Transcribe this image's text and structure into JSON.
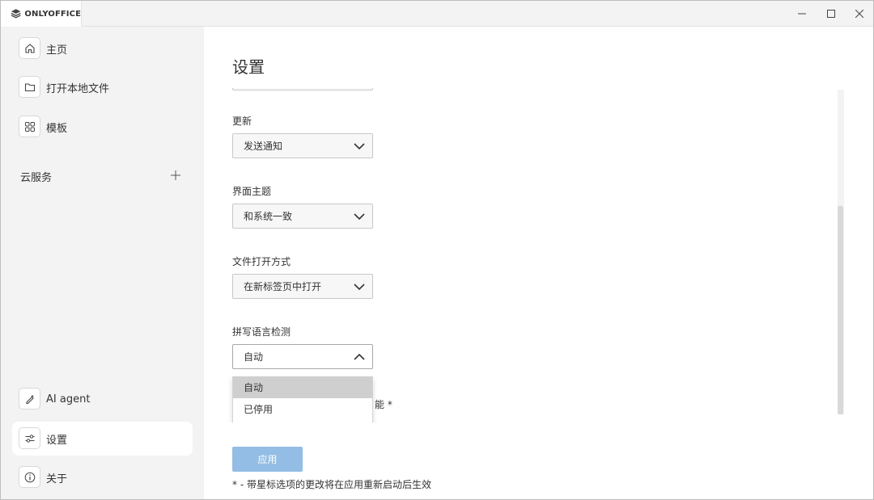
{
  "app": {
    "brand": "ONLYOFFICE"
  },
  "window_controls": {
    "minimize": "—",
    "maximize": "☐",
    "close": "✕"
  },
  "sidebar": {
    "items": [
      {
        "label": "主页",
        "icon": "home-icon"
      },
      {
        "label": "打开本地文件",
        "icon": "folder-icon"
      },
      {
        "label": "模板",
        "icon": "templates-icon"
      }
    ],
    "cloud_title": "云服务",
    "bottom_items": [
      {
        "label": "AI agent",
        "icon": "ai-agent-icon"
      },
      {
        "label": "设置",
        "icon": "settings-sliders-icon",
        "active": true
      },
      {
        "label": "关于",
        "icon": "info-icon"
      }
    ]
  },
  "main": {
    "title": "设置",
    "fields": {
      "update": {
        "label": "更新",
        "value": "发送通知"
      },
      "theme": {
        "label": "界面主题",
        "value": "和系统一致"
      },
      "open_mode": {
        "label": "文件打开方式",
        "value": "在新标签页中打开"
      },
      "spellcheck": {
        "label": "拼写语言检测",
        "value": "自动",
        "options": [
          "自动",
          "已停用"
        ],
        "selected_index": 0
      }
    },
    "partial_option_text": "能 *",
    "apply_label": "应用",
    "footnote": "* - 带星标选项的更改将在应用重新启动后生效"
  },
  "colors": {
    "sidebar_bg": "#f3f3f3",
    "apply_button": "#93bde4",
    "dropdown_selected": "#cfcfcf"
  }
}
